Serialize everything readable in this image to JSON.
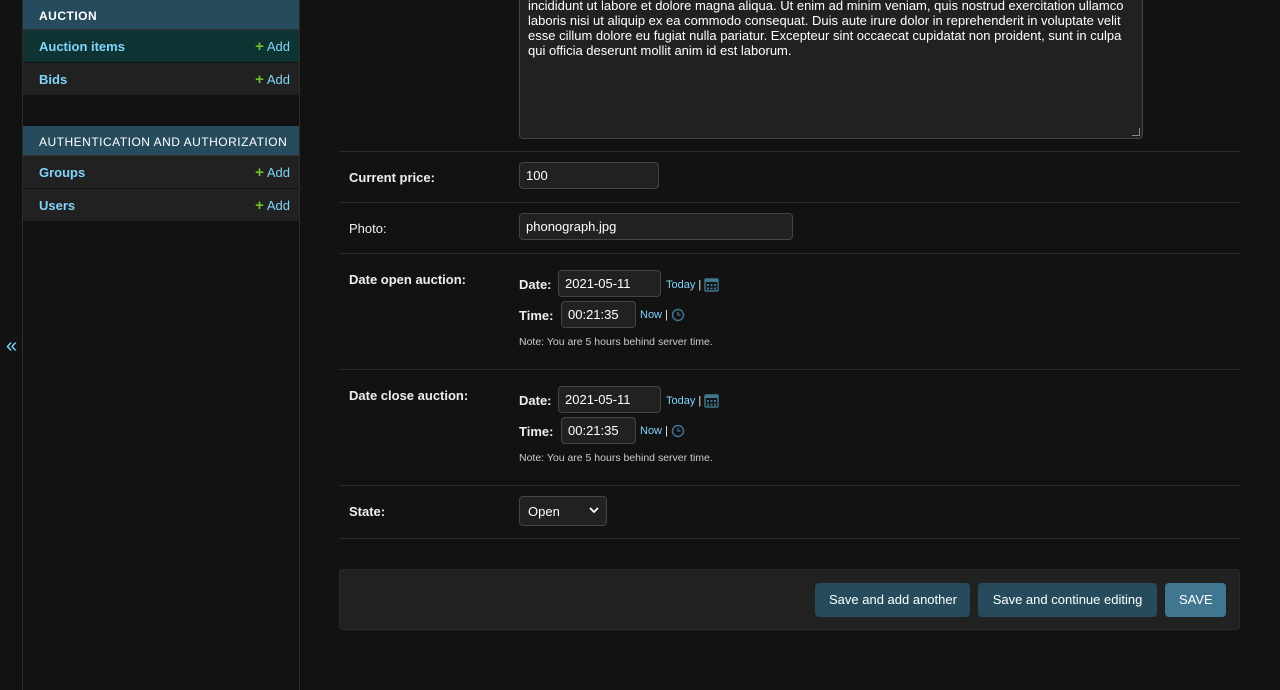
{
  "sidebar": {
    "toggle_label": "«",
    "modules": [
      {
        "caption": "AUCTION",
        "rows": [
          {
            "label": "Auction items",
            "add_label": "Add"
          },
          {
            "label": "Bids",
            "add_label": "Add"
          }
        ]
      },
      {
        "caption": "AUTHENTICATION AND AUTHORIZATION",
        "rows": [
          {
            "label": "Groups",
            "add_label": "Add"
          },
          {
            "label": "Users",
            "add_label": "Add"
          }
        ]
      }
    ]
  },
  "form": {
    "description_text": "incididunt ut labore et dolore magna aliqua. Ut enim ad minim veniam, quis nostrud exercitation ullamco laboris nisi ut aliquip ex ea commodo consequat. Duis aute irure dolor in reprehenderit in voluptate velit esse cillum dolore eu fugiat nulla pariatur. Excepteur sint occaecat cupidatat non proident, sunt in culpa qui officia deserunt mollit anim id est laborum.",
    "current_price": {
      "label": "Current price:",
      "value": "100"
    },
    "photo": {
      "label": "Photo:",
      "value": "phonograph.jpg"
    },
    "date_open": {
      "label": "Date open auction:",
      "date_label": "Date:",
      "date_value": "2021-05-11",
      "today_label": "Today",
      "time_label": "Time:",
      "time_value": "00:21:35",
      "now_label": "Now",
      "note": "Note: You are 5 hours behind server time."
    },
    "date_close": {
      "label": "Date close auction:",
      "date_label": "Date:",
      "date_value": "2021-05-11",
      "today_label": "Today",
      "time_label": "Time:",
      "time_value": "00:21:35",
      "now_label": "Now",
      "note": "Note: You are 5 hours behind server time."
    },
    "state": {
      "label": "State:",
      "selected": "Open"
    },
    "separator": "|"
  },
  "submit": {
    "save_add_another": "Save and add another",
    "save_continue": "Save and continue editing",
    "save": "SAVE"
  },
  "colors": {
    "accent_link": "#81d4fa",
    "add_plus": "#70bf2b",
    "header_bg": "#264b5d",
    "primary_button": "#417690"
  }
}
